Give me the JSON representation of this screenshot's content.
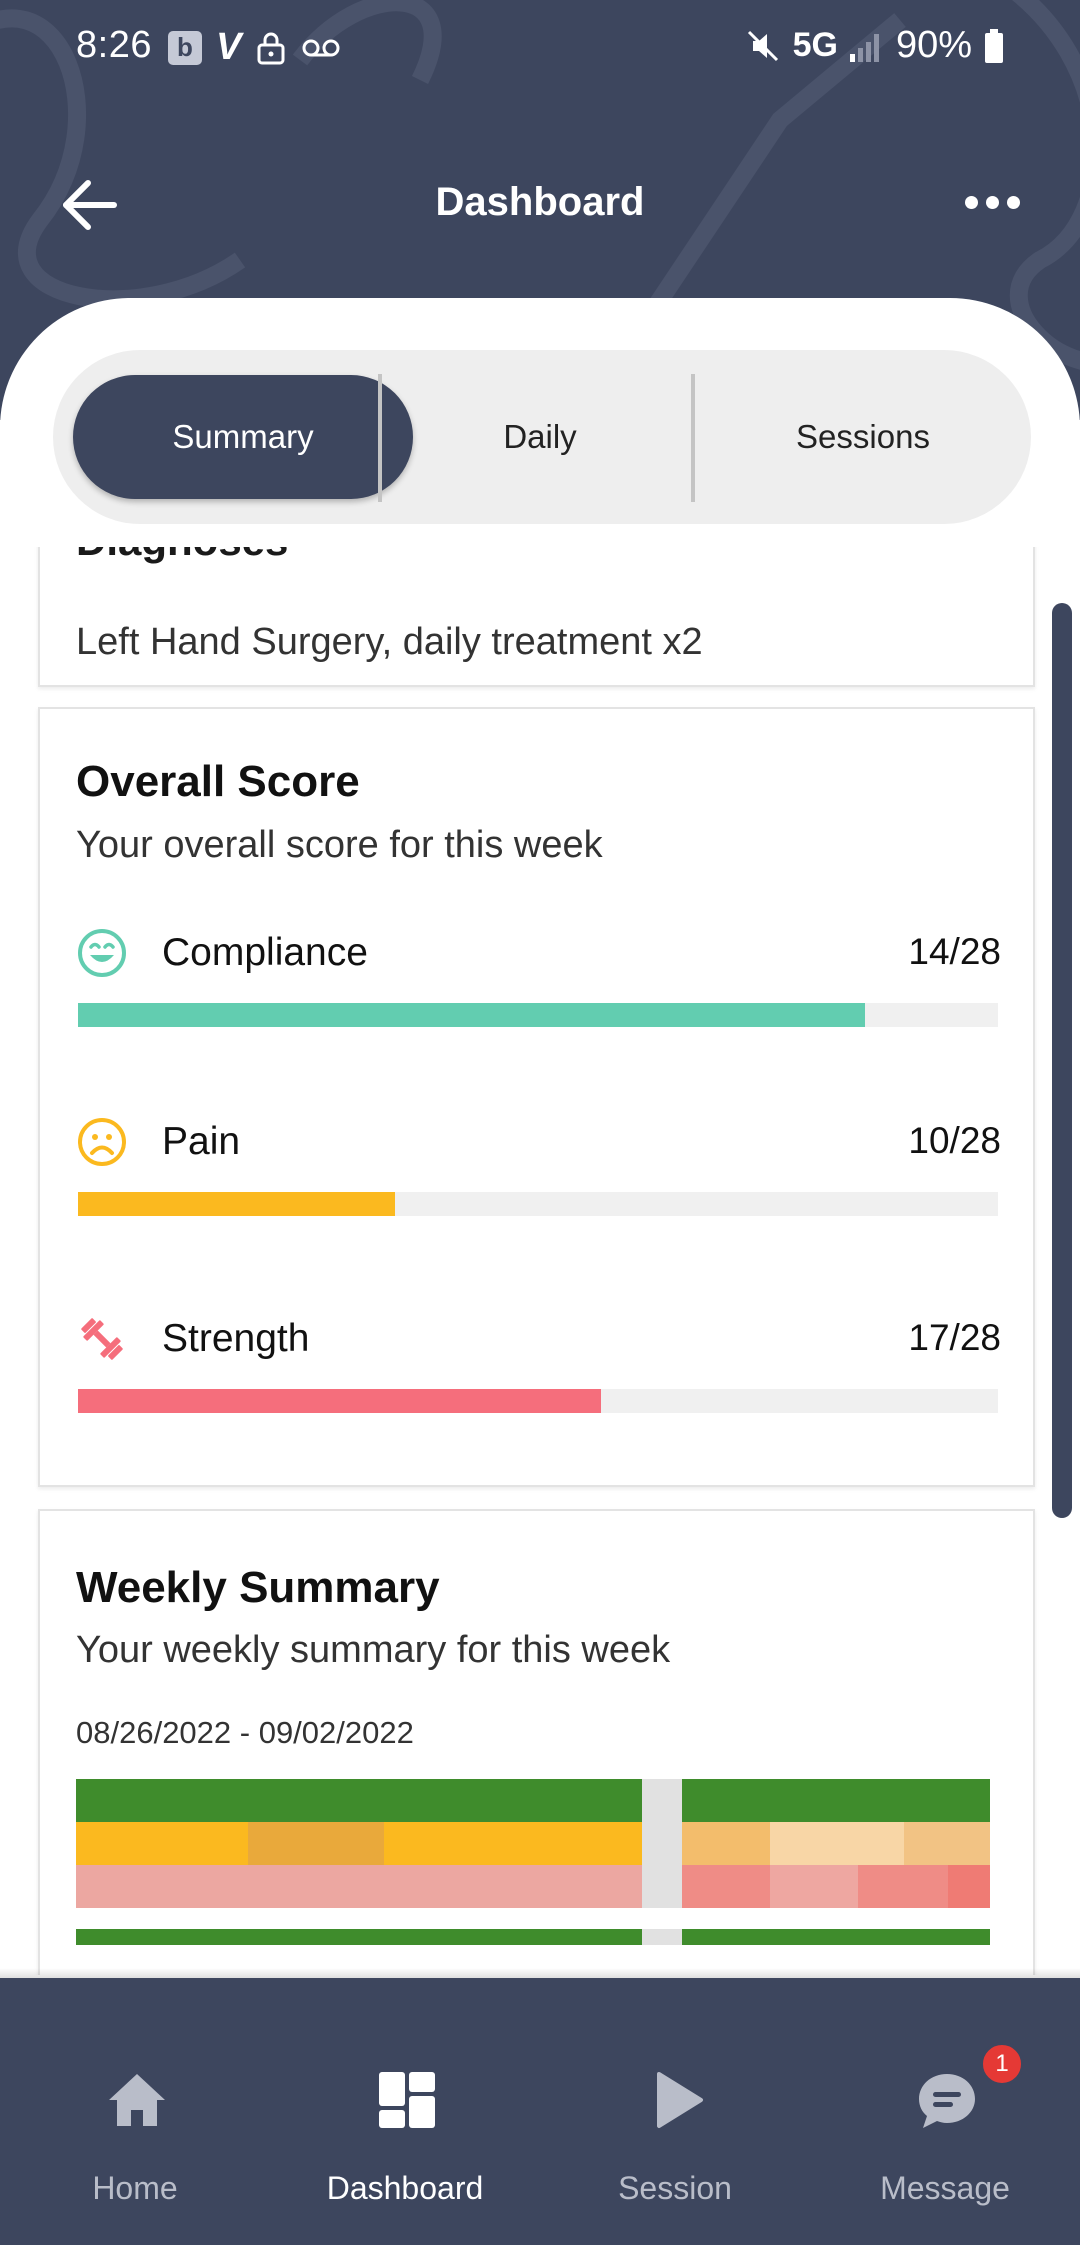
{
  "status_bar": {
    "time": "8:26",
    "network": "5G",
    "battery": "90%"
  },
  "header": {
    "title": "Dashboard"
  },
  "tabs": [
    {
      "label": "Summary",
      "active": true
    },
    {
      "label": "Daily",
      "active": false
    },
    {
      "label": "Sessions",
      "active": false
    }
  ],
  "diagnoses": {
    "title": "Diagnoses",
    "text": "Left Hand Surgery, daily treatment x2"
  },
  "overall_score": {
    "title": "Overall Score",
    "subtitle": "Your overall score for this week",
    "metrics": [
      {
        "label": "Compliance",
        "value": "14/28",
        "fill": 0.855,
        "color": "#62cdb0",
        "icon": "smile-face-icon"
      },
      {
        "label": "Pain",
        "value": "10/28",
        "fill": 0.345,
        "color": "#fbb91f",
        "icon": "sad-face-icon"
      },
      {
        "label": "Strength",
        "value": "17/28",
        "fill": 0.568,
        "color": "#f56e7c",
        "icon": "dumbbell-icon"
      }
    ]
  },
  "weekly_summary": {
    "title": "Weekly Summary",
    "subtitle": "Your weekly summary for this week",
    "date_range": "08/26/2022 - 09/02/2022"
  },
  "bottom_nav": {
    "items": [
      {
        "label": "Home",
        "icon": "home-icon",
        "active": false
      },
      {
        "label": "Dashboard",
        "icon": "dashboard-icon",
        "active": true
      },
      {
        "label": "Session",
        "icon": "play-icon",
        "active": false
      },
      {
        "label": "Message",
        "icon": "chat-icon",
        "active": false,
        "badge": "1"
      }
    ]
  },
  "colors": {
    "primary": "#3d465e",
    "compliance": "#62cdb0",
    "pain": "#fbb91f",
    "strength": "#f56e7c"
  }
}
